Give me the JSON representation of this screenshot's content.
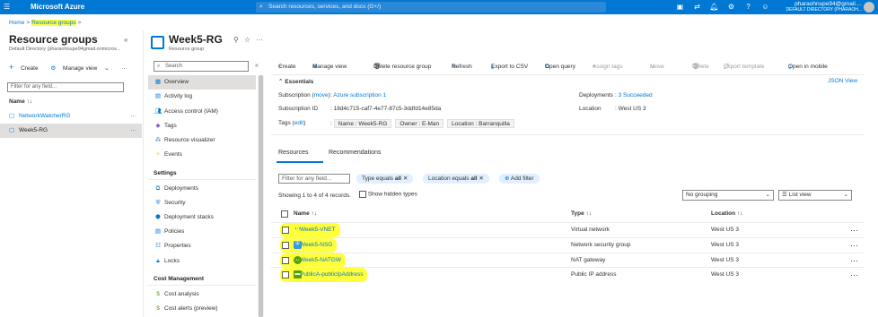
{
  "topbar": {
    "brand": "Microsoft Azure",
    "search_placeholder": "Search resources, services, and docs (G+/)",
    "user_email": "pharaohnupe94@gmail....",
    "user_directory": "DEFAULT DIRECTORY (PHARAOH..."
  },
  "breadcrumb": {
    "home": "Home",
    "current": "Resource groups"
  },
  "left": {
    "title": "Resource groups",
    "subtitle": "Default Directory (pharaohnupe94gmail.onmicros...",
    "create": "Create",
    "manage_view": "Manage view",
    "filter_placeholder": "Filter for any field...",
    "name_header": "Name ↑↓",
    "items": [
      {
        "label": "NetworkWatcherRG"
      },
      {
        "label": "Week5-RG"
      }
    ]
  },
  "rg": {
    "name": "Week5-RG",
    "type": "Resource group"
  },
  "nav": {
    "search_placeholder": "Search",
    "items": [
      {
        "label": "Overview",
        "icon": "overview-icon"
      },
      {
        "label": "Activity log",
        "icon": "activity-log-icon"
      },
      {
        "label": "Access control (IAM)",
        "icon": "iam-icon"
      },
      {
        "label": "Tags",
        "icon": "tag-icon"
      },
      {
        "label": "Resource visualizer",
        "icon": "visualizer-icon"
      },
      {
        "label": "Events",
        "icon": "events-icon"
      }
    ],
    "settings_header": "Settings",
    "settings": [
      {
        "label": "Deployments",
        "icon": "deployments-icon"
      },
      {
        "label": "Security",
        "icon": "security-icon"
      },
      {
        "label": "Deployment stacks",
        "icon": "stacks-icon"
      },
      {
        "label": "Policies",
        "icon": "policies-icon"
      },
      {
        "label": "Properties",
        "icon": "properties-icon"
      },
      {
        "label": "Locks",
        "icon": "lock-icon"
      }
    ],
    "cost_header": "Cost Management",
    "cost": [
      {
        "label": "Cost analysis",
        "icon": "cost-analysis-icon"
      },
      {
        "label": "Cost alerts (preview)",
        "icon": "cost-alerts-icon"
      }
    ]
  },
  "commands": {
    "create": "Create",
    "manage_view": "Manage view",
    "delete_rg": "Delete resource group",
    "refresh": "Refresh",
    "export_csv": "Export to CSV",
    "open_query": "Open query",
    "assign_tags": "Assign tags",
    "move": "Move",
    "delete": "Delete",
    "export_template": "Export template",
    "open_mobile": "Open in mobile"
  },
  "essentials": {
    "title": "Essentials",
    "json_view": "JSON View",
    "subscription_label": "Subscription (",
    "move_link": "move",
    "subscription_suffix": ")",
    "subscription_value": "Azure subscription 1",
    "subscription_id_label": "Subscription ID",
    "subscription_id": "18d4c715-caf7-4e77-87c5-3ddfd14e85da",
    "tags_label": "Tags (",
    "edit_link": "edit",
    "tags_suffix": ")",
    "tags": [
      "Name : Week5-RG",
      "Owner : E-Man",
      "Location : Barranquilla"
    ],
    "deployments_label": "Deployments",
    "deployments_value": "3 Succeeded",
    "location_label": "Location",
    "location_value": "West US 3"
  },
  "tabs": {
    "resources": "Resources",
    "recommendations": "Recommendations"
  },
  "filters": {
    "placeholder": "Filter for any field...",
    "type_pill_prefix": "Type equals ",
    "type_pill_value": "all",
    "location_pill_prefix": "Location equals ",
    "location_pill_value": "all",
    "add_filter": "Add filter"
  },
  "summary": {
    "showing": "Showing 1 to 4 of 4 records.",
    "show_hidden": "Show hidden types",
    "grouping": "No grouping",
    "view": "List view"
  },
  "table": {
    "headers": {
      "name": "Name ↑↓",
      "type": "Type ↑↓",
      "location": "Location ↑↓"
    },
    "rows": [
      {
        "name": "Week5-VNET",
        "type": "Virtual network",
        "location": "West US 3",
        "icon": "vnet-icon"
      },
      {
        "name": "Week5-NSG",
        "type": "Network security group",
        "location": "West US 3",
        "icon": "nsg-icon"
      },
      {
        "name": "Week5-NATGW",
        "type": "NAT gateway",
        "location": "West US 3",
        "icon": "nat-gateway-icon"
      },
      {
        "name": "PublicA-publicIpAddress",
        "type": "Public IP address",
        "location": "West US 3",
        "icon": "public-ip-icon"
      }
    ]
  },
  "colors": {
    "accent": "#0078d4",
    "highlight": "#ffff3b"
  }
}
